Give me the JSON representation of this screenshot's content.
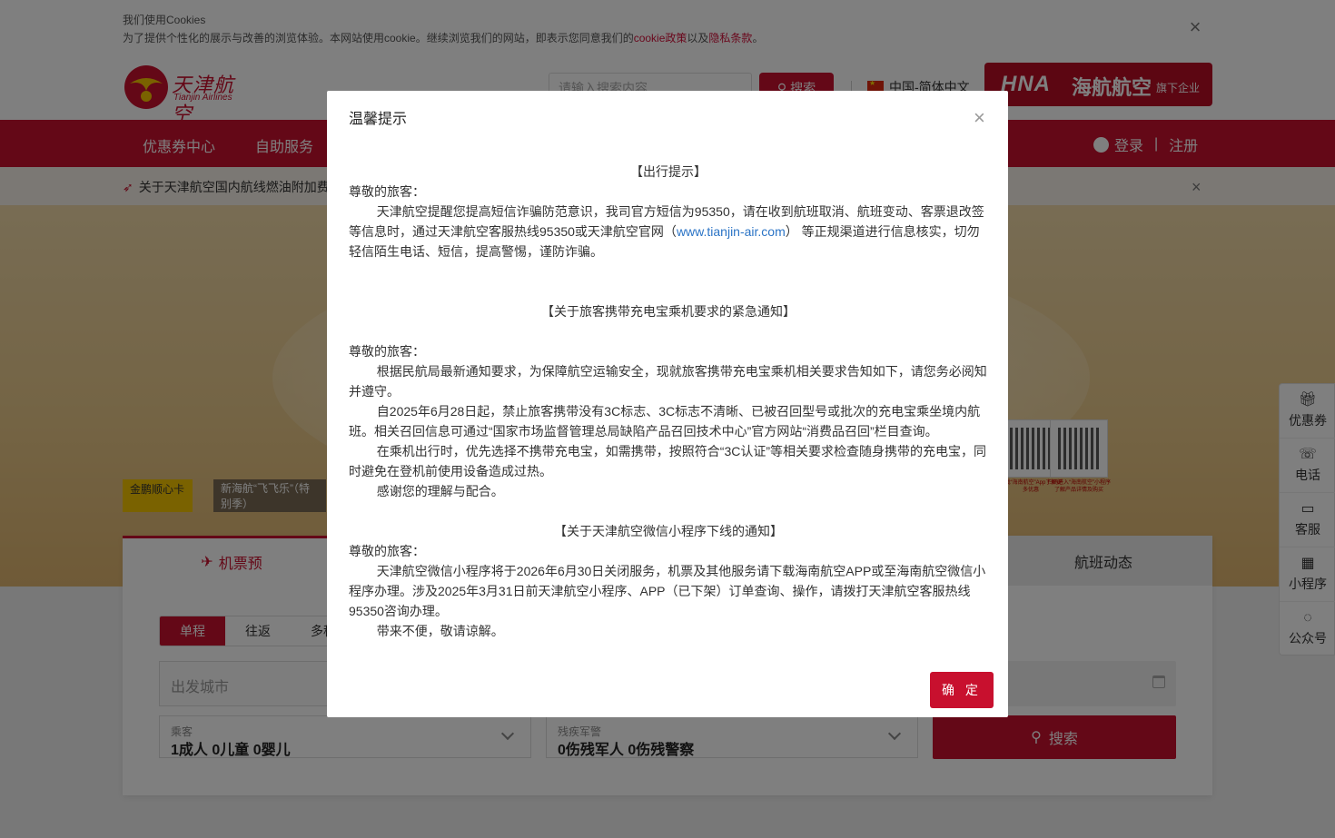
{
  "cookie_bar": {
    "title": "我们使用Cookies",
    "text_before": "为了提供个性化的展示与改善的浏览体验。本网站使用cookie。继续浏览我们的网站，即表示您同意我们的",
    "cookie_link": "cookie政策",
    "and": "以及",
    "privacy_link": "隐私条款",
    "end": "。",
    "close": "×"
  },
  "header": {
    "logo_cn": "天津航空",
    "logo_en": "Tianjin Airlines",
    "search_placeholder": "请输入搜索内容",
    "search_button": "搜索",
    "language": "中国-简体中文",
    "hna_logo": "HNA",
    "hna_name": "海航航空",
    "hna_sub": "旗下企业"
  },
  "nav": {
    "items": [
      "优惠券中心",
      "自助服务"
    ],
    "login": "登录",
    "sep": "|",
    "register": "注册"
  },
  "notice": {
    "text": "关于天津航空国内航线燃油附加费",
    "close": "×"
  },
  "banner": {
    "card1": "金鹏顺心卡",
    "card2": "新海航“飞飞乐”（特别季）",
    "qr1_caption": "下载“海南航空”App了解更多优惠",
    "qr2_caption": "扫码进入“海南航空”小程序了解产品详情及购买"
  },
  "booking": {
    "tab_flight": "机票预",
    "tab_status": "航班动态",
    "trip_types": [
      "单程",
      "往返",
      "多程"
    ],
    "from_placeholder": "出发城市",
    "passenger_label": "乘客",
    "passenger_value": "1成人   0儿童   0婴儿",
    "disabled_label": "残疾军警",
    "disabled_value": "0伤残军人   0伤残警察",
    "search": "搜索"
  },
  "side_bar": [
    "优惠券",
    "电话",
    "客服",
    "小程序",
    "公众号"
  ],
  "modal": {
    "title": "温馨提示",
    "close": "×",
    "h1": "【出行提示】",
    "greet": "尊敬的旅客：",
    "p1a": "天津航空提醒您提高短信诈骗防范意识，我司官方短信为95350，请在收到航班取消、航班变动、客票退改签等信息时，通过天津航空客服热线95350或天津航空官网（",
    "p1link": "www.tianjin-air.com",
    "p1b": "） 等正规渠道进行信息核实，切勿轻信陌生电话、短信，提高警惕，谨防诈骗。",
    "h2": "【关于旅客携带充电宝乘机要求的紧急通知】",
    "p2": "根据民航局最新通知要求，为保障航空运输安全，现就旅客携带充电宝乘机相关要求告知如下，请您务必阅知并遵守。",
    "p3": "自2025年6月28日起，禁止旅客携带没有3C标志、3C标志不清晰、已被召回型号或批次的充电宝乘坐境内航班。相关召回信息可通过“国家市场监督管理总局缺陷产品召回技术中心”官方网站“消费品召回”栏目查询。",
    "p4": "在乘机出行时，优先选择不携带充电宝，如需携带，按照符合“3C认证”等相关要求检查随身携带的充电宝，同时避免在登机前使用设备造成过热。",
    "p5": "感谢您的理解与配合。",
    "h3": "【关于天津航空微信小程序下线的通知】",
    "p6": "天津航空微信小程序将于2026年6月30日关闭服务，机票及其他服务请下载海南航空APP或至海南航空微信小程序办理。涉及2025年3月31日前天津航空小程序、APP（已下架）订单查询、操作，请拨打天津航空客服热线95350咨询办理。",
    "p7": "带来不便，敬请谅解。",
    "ok": "确 定"
  },
  "colors": {
    "brand": "#c8102e",
    "hna": "#b80c24",
    "link": "#2b74c6"
  }
}
